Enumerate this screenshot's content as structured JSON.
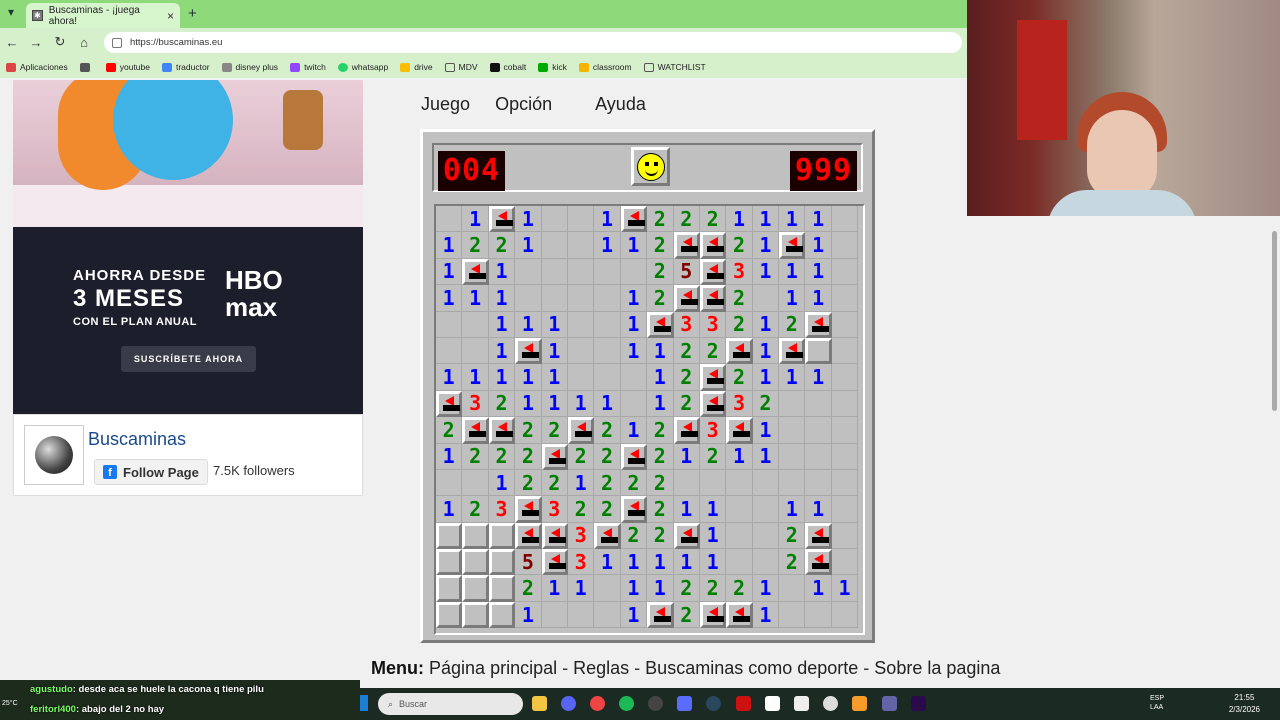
{
  "browser": {
    "tab_title": "Buscaminas - ¡juega ahora!",
    "url": "https://buscaminas.eu",
    "bookmarks": [
      "Aplicaciones",
      "youtube",
      "traductor",
      "disney plus",
      "twitch",
      "whatsapp",
      "drive",
      "MDV",
      "cobalt",
      "kick",
      "classroom",
      "WATCHLIST"
    ]
  },
  "ad": {
    "line1": "AHORRA DESDE",
    "line2": "3 MESES",
    "line3": "CON EL PLAN ANUAL",
    "brand": "HBO max",
    "button": "SUSCRÍBETE AHORA"
  },
  "facebook": {
    "page_name": "Buscaminas",
    "follow_label": "Follow Page",
    "followers": "7.5K followers"
  },
  "game": {
    "menu": [
      "Juego",
      "Opción",
      "Ayuda"
    ],
    "mine_counter": "004",
    "timer": "999",
    "face": "smiley",
    "grid": [
      [
        "",
        "1",
        "F",
        "1",
        "",
        "",
        "1",
        "F",
        "2",
        "2",
        "2",
        "1",
        "1",
        "1",
        "1",
        ""
      ],
      [
        "1",
        "2",
        "2",
        "1",
        "",
        "",
        "1",
        "1",
        "2",
        "F",
        "F",
        "2",
        "1",
        "F",
        "1",
        ""
      ],
      [
        "1",
        "F",
        "1",
        "",
        "",
        "",
        "",
        "",
        "2",
        "5",
        "F",
        "3",
        "1",
        "1",
        "1",
        ""
      ],
      [
        "1",
        "1",
        "1",
        "",
        "",
        "",
        "",
        "1",
        "2",
        "F",
        "F",
        "2",
        "",
        "1",
        "1",
        ""
      ],
      [
        "",
        "",
        "1",
        "1",
        "1",
        "",
        "",
        "1",
        "F",
        "3",
        "3",
        "2",
        "1",
        "2",
        "F",
        ""
      ],
      [
        "",
        "",
        "1",
        "F",
        "1",
        "",
        "",
        "1",
        "1",
        "2",
        "2",
        "F",
        "1",
        "F",
        "H",
        ""
      ],
      [
        "1",
        "1",
        "1",
        "1",
        "1",
        "",
        "",
        "",
        "1",
        "2",
        "F",
        "2",
        "1",
        "1",
        "1",
        ""
      ],
      [
        "F",
        "3",
        "2",
        "1",
        "1",
        "1",
        "1",
        "",
        "1",
        "2",
        "F",
        "3",
        "2",
        "",
        "",
        ""
      ],
      [
        "2",
        "F",
        "F",
        "2",
        "2",
        "F",
        "2",
        "1",
        "2",
        "F",
        "3",
        "F",
        "1",
        "",
        "",
        ""
      ],
      [
        "1",
        "2",
        "2",
        "2",
        "F",
        "2",
        "2",
        "F",
        "2",
        "1",
        "2",
        "1",
        "1",
        "",
        "",
        ""
      ],
      [
        "",
        "",
        "1",
        "2",
        "2",
        "1",
        "2",
        "2",
        "2",
        "",
        "",
        "",
        "",
        "",
        "",
        ""
      ],
      [
        "1",
        "2",
        "3",
        "F",
        "3",
        "2",
        "2",
        "F",
        "2",
        "1",
        "1",
        "",
        "",
        "1",
        "1",
        ""
      ],
      [
        "H",
        "H",
        "H",
        "F",
        "F",
        "3",
        "F",
        "2",
        "2",
        "F",
        "1",
        "",
        "",
        "2",
        "F",
        ""
      ],
      [
        "H",
        "H",
        "H",
        "5",
        "F",
        "3",
        "1",
        "1",
        "1",
        "1",
        "1",
        "",
        "",
        "2",
        "F",
        ""
      ],
      [
        "H",
        "H",
        "H",
        "2",
        "1",
        "1",
        "",
        "1",
        "1",
        "2",
        "2",
        "2",
        "1",
        "",
        "1",
        "1"
      ],
      [
        "H",
        "H",
        "H",
        "1",
        "",
        "",
        "",
        "1",
        "F",
        "2",
        "F",
        "F",
        "1",
        "",
        "",
        ""
      ]
    ]
  },
  "footer_menu": {
    "label": "Menu:",
    "links": [
      "Página principal",
      "Reglas",
      "Buscaminas como deporte",
      "Sobre la pagina"
    ]
  },
  "chat": [
    {
      "user": "agustudo",
      "text": ": desde aca se huele la cacona q tiene pilu"
    },
    {
      "user": "feritorl400",
      "text": ": abajo del 2 no hay"
    }
  ],
  "taskbar": {
    "search_placeholder": "Buscar",
    "lang_line1": "ESP",
    "lang_line2": "LAA",
    "time": "21:55",
    "date": "2/3/2026",
    "weather": "25°C"
  }
}
